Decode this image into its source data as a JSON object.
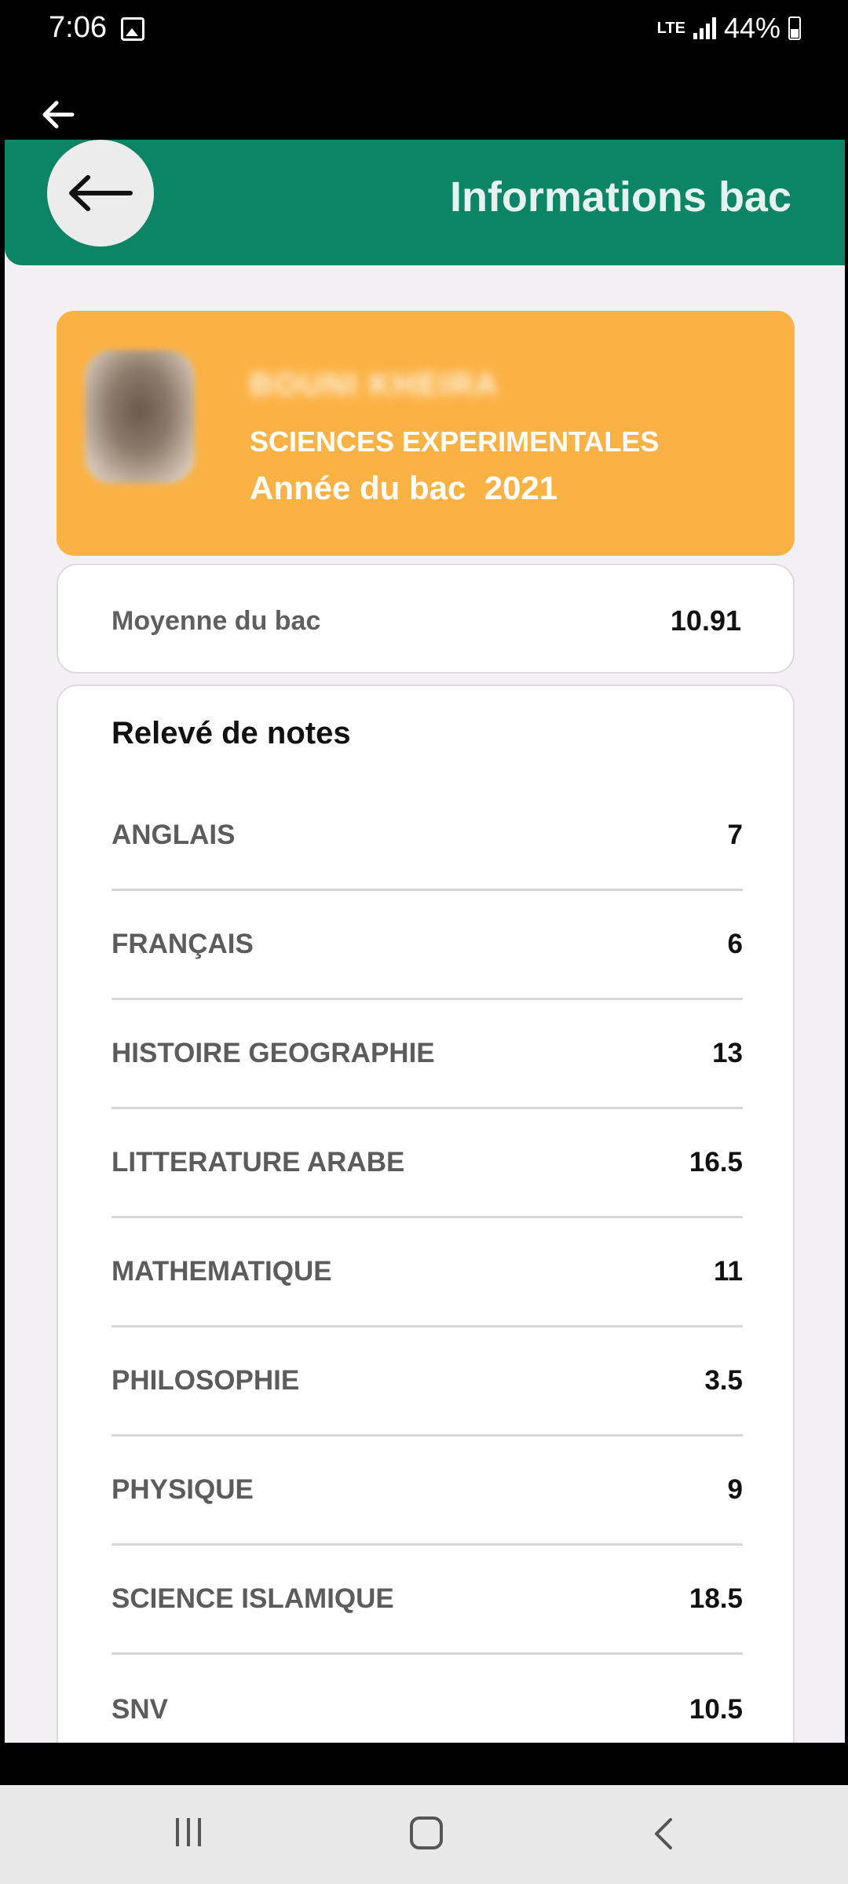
{
  "status": {
    "time": "7:06",
    "network": "LTE",
    "battery": "44%"
  },
  "header": {
    "title": "Informations bac"
  },
  "profile": {
    "name": "BOUNI KHEIRA",
    "stream": "SCIENCES EXPERIMENTALES",
    "year_text": "Année du bac  2021"
  },
  "average": {
    "label": "Moyenne du bac",
    "value": "10.91"
  },
  "grades": {
    "title": "Relevé de notes",
    "rows": [
      {
        "subject": "ANGLAIS",
        "note": "7"
      },
      {
        "subject": "FRANÇAIS",
        "note": "6"
      },
      {
        "subject": "HISTOIRE GEOGRAPHIE",
        "note": "13"
      },
      {
        "subject": "LITTERATURE ARABE",
        "note": "16.5"
      },
      {
        "subject": "MATHEMATIQUE",
        "note": "11"
      },
      {
        "subject": "PHILOSOPHIE",
        "note": "3.5"
      },
      {
        "subject": "PHYSIQUE",
        "note": "9"
      },
      {
        "subject": "SCIENCE ISLAMIQUE",
        "note": "18.5"
      },
      {
        "subject": "SNV",
        "note": "10.5"
      }
    ]
  },
  "colors": {
    "header": "#0b8566",
    "profile_card": "#fbb245",
    "background": "#f2f0f3"
  },
  "icons": {
    "top_back": "arrow-left-icon",
    "header_back": "arrow-left-icon",
    "nav_recent": "recent-apps-icon",
    "nav_home": "home-icon",
    "nav_back": "chevron-left-icon"
  }
}
